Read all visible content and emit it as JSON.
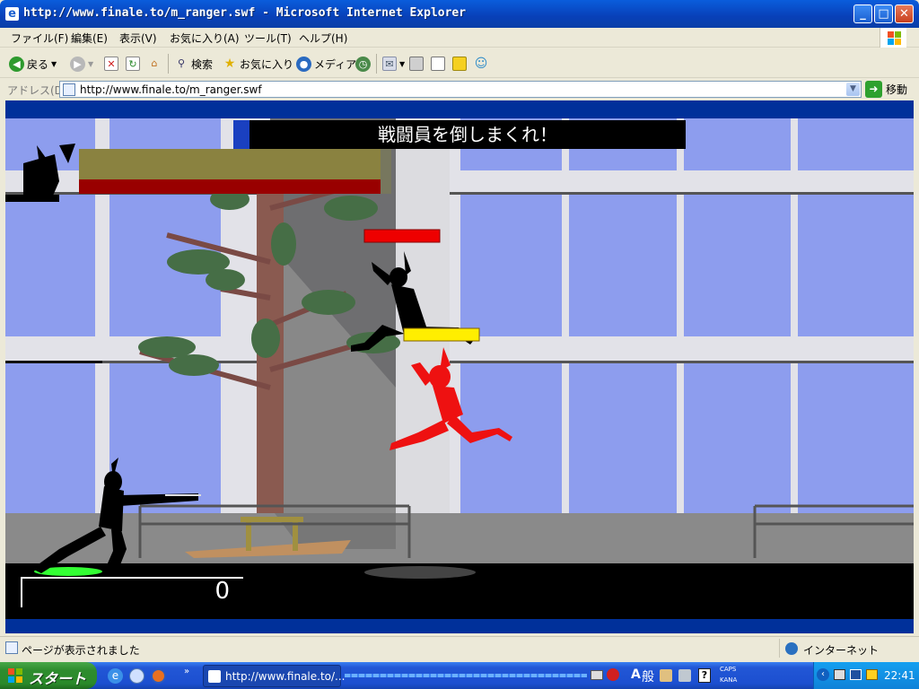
{
  "window": {
    "title": "http://www.finale.to/m_ranger.swf - Microsoft Internet Explorer",
    "controls": {
      "minimize": "_",
      "maximize": "□",
      "close": "✕"
    }
  },
  "menu": {
    "items": [
      "ファイル(F)",
      "編集(E)",
      "表示(V)",
      "お気に入り(A)",
      "ツール(T)",
      "ヘルプ(H)"
    ]
  },
  "toolbar": {
    "back_label": "戻る",
    "search_label": "検索",
    "favorites_label": "お気に入り",
    "media_label": "メディア"
  },
  "address": {
    "label": "アドレス(D)",
    "url": "http://www.finale.to/m_ranger.swf",
    "go_label": "移動"
  },
  "game": {
    "mission_text": "戦闘員を倒しまくれ！",
    "score": "0",
    "colors": {
      "sky": "#8d9dee",
      "enemy_health_bar": "#ee0000",
      "hit_marker": "#ffee00",
      "red_ranger": "#ee1111",
      "player_glow": "#33ff33"
    },
    "icons": [
      "player-ninja",
      "enemy-soldier",
      "red-ranger",
      "tree",
      "bench"
    ]
  },
  "status": {
    "text": "ページが表示されました",
    "zone": "インターネット"
  },
  "taskbar": {
    "start_label": "スタート",
    "window_button": "http://www.finale.to/...",
    "ime": {
      "mode": "A",
      "kanji": "般"
    },
    "caps": "CAPS",
    "kana": "KANA",
    "clock": "22:41"
  }
}
